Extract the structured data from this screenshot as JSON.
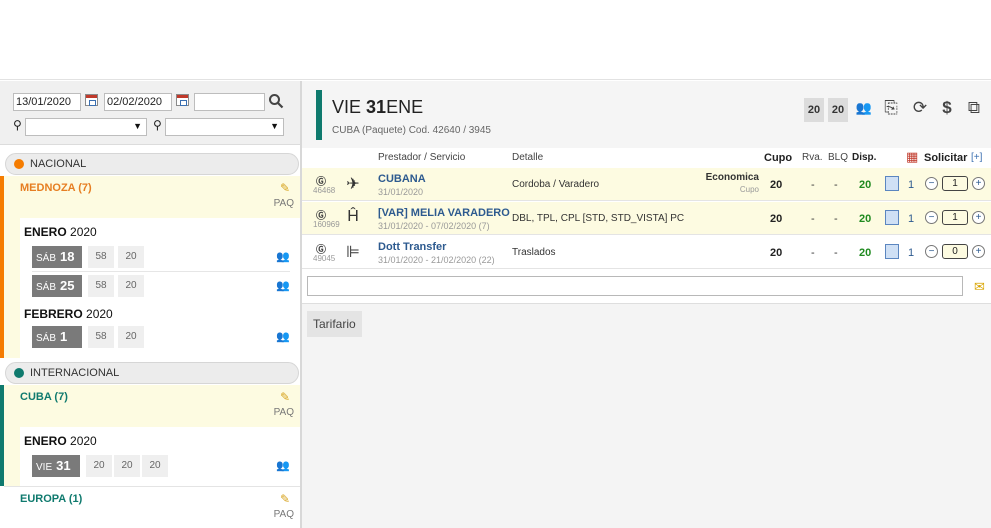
{
  "filters": {
    "date_from": "13/01/2020",
    "date_to": "02/02/2020",
    "extra_date": ""
  },
  "sections": [
    {
      "label": "NACIONAL",
      "dot_color": "#f57c00",
      "stripe_color": "#f57c00",
      "destination": {
        "name": "MEDNOZA (7)",
        "name_color": "#e67e22",
        "paq": "PAQ"
      },
      "months": [
        {
          "month": "ENERO",
          "year": "2020",
          "days": [
            {
              "dow": "SÁB",
              "day": "18",
              "c1": "58",
              "c2": "20"
            },
            {
              "dow": "SÁB",
              "day": "25",
              "c1": "58",
              "c2": "20"
            }
          ]
        },
        {
          "month": "FEBRERO",
          "year": "2020",
          "days": [
            {
              "dow": "SÁB",
              "day": "1",
              "c1": "58",
              "c2": "20"
            }
          ]
        }
      ]
    },
    {
      "label": "INTERNACIONAL",
      "dot_color": "#0f7a6e",
      "stripe_color": "#0f7a6e",
      "destination": {
        "name": "CUBA (7)",
        "name_color": "#0f7a6e",
        "paq": "PAQ"
      },
      "months": [
        {
          "month": "ENERO",
          "year": "2020",
          "days": [
            {
              "dow": "VIE",
              "day": "31",
              "c1": "20",
              "c2": "20",
              "c3": "20"
            }
          ]
        }
      ]
    }
  ],
  "europa": {
    "name": "EUROPA (1)",
    "paq": "PAQ"
  },
  "header": {
    "dow": "VIE",
    "day": "31",
    "month": "ENE",
    "subtitle": "CUBA (Paquete) Cod. 42640 / 3945",
    "box1": "20",
    "box2": "20"
  },
  "columns": {
    "prestador": "Prestador / Servicio",
    "detalle": "Detalle",
    "cupo": "Cupo",
    "rva": "Rva.",
    "blq": "BLQ",
    "disp": "Disp.",
    "solicitar": "Solicitar",
    "add": "[+]"
  },
  "services": [
    {
      "code": "46468",
      "icon": "plane-icon",
      "glyph": "✈",
      "name": "CUBANA",
      "date": "31/01/2020",
      "detalle": "Cordoba / Varadero",
      "clase": "Economica",
      "clase_sub": "Cupo",
      "cupo": "20",
      "rva": "-",
      "blq": "-",
      "disp": "20",
      "qty": "1",
      "value": "1",
      "highlight": true
    },
    {
      "code": "160969",
      "icon": "hotel-icon",
      "glyph": "Ĥ",
      "name": "[VAR] MELIA VARADERO",
      "date": "31/01/2020 - 07/02/2020 (7)",
      "detalle": "DBL, TPL, CPL [STD, STD_VISTA] PC",
      "clase": "",
      "clase_sub": "",
      "cupo": "20",
      "rva": "-",
      "blq": "-",
      "disp": "20",
      "qty": "1",
      "value": "1",
      "highlight": true
    },
    {
      "code": "49045",
      "icon": "transfer-icon",
      "glyph": "⊫",
      "name": "Dott Transfer",
      "date": "31/01/2020 - 21/02/2020 (22)",
      "detalle": "Traslados",
      "clase": "",
      "clase_sub": "",
      "cupo": "20",
      "rva": "-",
      "blq": "-",
      "disp": "20",
      "qty": "1",
      "value": "0",
      "highlight": false
    }
  ],
  "tarifario": "Tarifario"
}
